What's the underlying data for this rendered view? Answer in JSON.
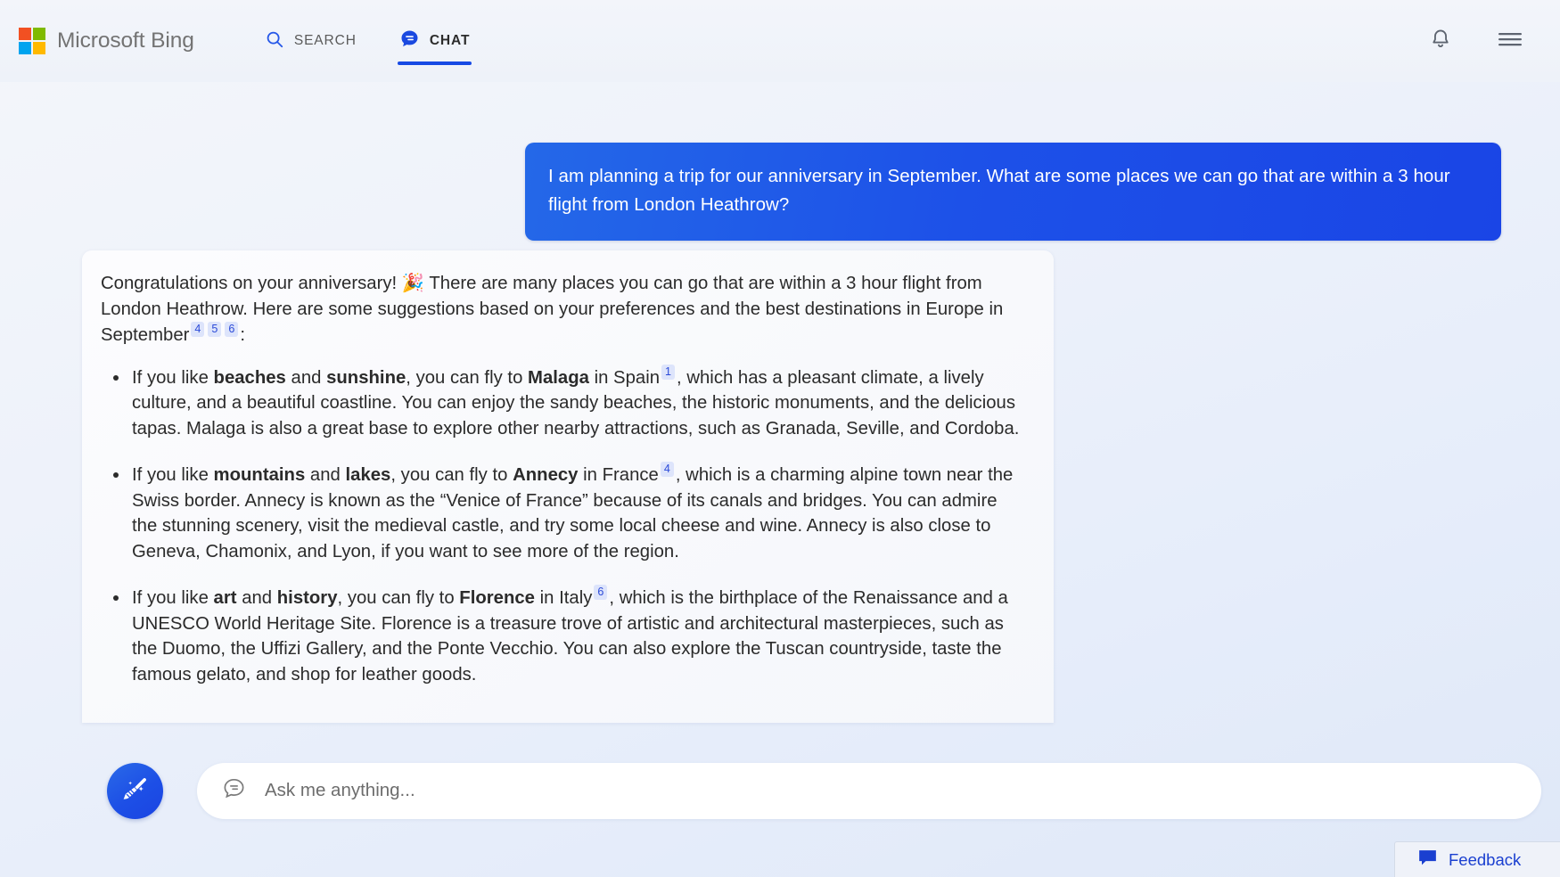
{
  "header": {
    "brand_name": "Microsoft Bing",
    "logo_colors": [
      "#f25022",
      "#7fba00",
      "#00a4ef",
      "#ffb900"
    ],
    "tabs": [
      {
        "label": "SEARCH",
        "icon": "search-icon",
        "active": false
      },
      {
        "label": "CHAT",
        "icon": "chat-bubble-icon",
        "active": true
      }
    ],
    "notifications_icon": "bell-icon",
    "menu_icon": "hamburger-menu-icon",
    "accent_color": "#174ae4"
  },
  "conversation": {
    "user_message": "I am planning a trip for our anniversary in September. What are some places we can go that are within a 3 hour flight from London Heathrow?",
    "answer": {
      "intro_part1": "Congratulations on your anniversary! ",
      "intro_emoji": "🎉",
      "intro_part2": " There are many places you can go that are within a 3 hour flight from London Heathrow. Here are some suggestions based on your preferences and the best destinations in Europe in September",
      "intro_citations": [
        "4",
        "5",
        "6"
      ],
      "intro_end": ":",
      "bullets": [
        {
          "lead": "If you like ",
          "bold1": "beaches",
          "mid1": " and ",
          "bold2": "sunshine",
          "mid2": ", you can fly to ",
          "place": "Malaga",
          "after_place": " in Spain",
          "citation": "1",
          "rest": ", which has a pleasant climate, a lively culture, and a beautiful coastline. You can enjoy the sandy beaches, the historic monuments, and the delicious tapas. Malaga is also a great base to explore other nearby attractions, such as Granada, Seville, and Cordoba."
        },
        {
          "lead": "If you like ",
          "bold1": "mountains",
          "mid1": " and ",
          "bold2": "lakes",
          "mid2": ", you can fly to ",
          "place": "Annecy",
          "after_place": " in France",
          "citation": "4",
          "rest": ", which is a charming alpine town near the Swiss border. Annecy is known as the “Venice of France” because of its canals and bridges. You can admire the stunning scenery, visit the medieval castle, and try some local cheese and wine. Annecy is also close to Geneva, Chamonix, and Lyon, if you want to see more of the region."
        },
        {
          "lead": "If you like ",
          "bold1": "art",
          "mid1": " and ",
          "bold2": "history",
          "mid2": ", you can fly to ",
          "place": "Florence",
          "after_place": " in Italy",
          "citation": "6",
          "rest": ", which is the birthplace of the Renaissance and a UNESCO World Heritage Site. Florence is a treasure trove of artistic and architectural masterpieces, such as the Duomo, the Uffizi Gallery, and the Ponte Vecchio. You can also explore the Tuscan countryside, taste the famous gelato, and shop for leather goods."
        }
      ]
    },
    "user_bubble_color": "#1d51e8",
    "citation_bg_color": "#dde4fb",
    "citation_text_color": "#2b4ad8"
  },
  "composer": {
    "new_topic_icon": "broom-sweep-icon",
    "input_icon": "chat-bubble-outline-icon",
    "placeholder": "Ask me anything...",
    "value": ""
  },
  "feedback": {
    "label": "Feedback",
    "icon": "feedback-chat-icon",
    "color": "#1a3fd0"
  }
}
